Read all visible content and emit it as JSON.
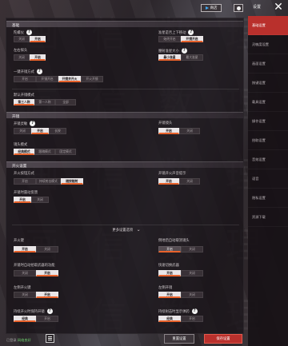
{
  "header": {
    "store_label": "商店",
    "settings_title": "设置"
  },
  "sidebar": {
    "items": [
      {
        "label": "基础设置",
        "active": true
      },
      {
        "label": "灵敏度设置",
        "active": false
      },
      {
        "label": "画面设置",
        "active": false
      },
      {
        "label": "按键设置",
        "active": false
      },
      {
        "label": "载具设置",
        "active": false
      },
      {
        "label": "操作设置",
        "active": false
      },
      {
        "label": "拾取设置",
        "active": false
      },
      {
        "label": "音效设置",
        "active": false
      },
      {
        "label": "语音",
        "active": false
      },
      {
        "label": "隐私设置",
        "active": false
      },
      {
        "label": "资源下载",
        "active": false
      }
    ]
  },
  "sections": {
    "basic": "基础",
    "shoot": "开镜",
    "shooting_settings": "开火设置"
  },
  "settings": [
    {
      "label": "陀螺仪",
      "help": true,
      "options": [
        "关闭",
        "开启"
      ],
      "selected": 1
    },
    {
      "label": "准星是否上下移动",
      "help": true,
      "options": [
        "始终开启",
        "开镜开启"
      ],
      "selected": 1
    },
    {
      "label": "左右探头",
      "help": false,
      "options": [
        "关闭",
        "开启"
      ],
      "selected": 1
    },
    {
      "label": "腰射准星大小",
      "help": true,
      "options": [
        "最小准星",
        "最大准星"
      ],
      "selected": 0
    },
    {
      "label": "一键开镜方式",
      "help": true,
      "options": [
        "开启",
        "开镜开启",
        "开镜并开火",
        "开火开镜"
      ],
      "selected": 2
    },
    {
      "label": "默认开镜模式",
      "help": false,
      "options": [
        "第三人称",
        "第一人称",
        "全部"
      ],
      "selected": 0
    },
    {
      "label": "开镜灵敏",
      "help": true,
      "options": [
        "关闭",
        "开启",
        "长按"
      ],
      "selected": 1
    },
    {
      "label": "开镜镜头",
      "help": false,
      "options": [
        "开启",
        "关闭"
      ],
      "selected": 0
    },
    {
      "label": "镜头模式",
      "help": false,
      "options": [
        "经典模式",
        "跟随模式",
        "固定模式"
      ],
      "selected": 0
    },
    {
      "label": "开火按钮方式",
      "help": false,
      "options": [
        "开启",
        "持续射击模式",
        "随按随射"
      ],
      "selected": 2
    },
    {
      "label": "开镜开火声音提示",
      "help": false,
      "options": [
        "开启",
        "关闭"
      ],
      "selected": 0
    },
    {
      "label": "开镜时震动反馈",
      "help": false,
      "options": [
        "开启",
        "关闭"
      ],
      "selected": 0
    },
    {
      "label": "开火键",
      "help": false,
      "options": [
        "开启",
        "关闭"
      ],
      "selected": 0
    },
    {
      "label": "倒地后自动取消镜头",
      "help": false,
      "options": [
        "开启",
        "关闭"
      ],
      "selected": 0
    },
    {
      "label": "开镜时自动拾取武器的功能",
      "help": false,
      "options": [
        "关闭",
        "开启"
      ],
      "selected": 1
    },
    {
      "label": "快速切换武器",
      "help": false,
      "options": [
        "开启",
        "关闭"
      ],
      "selected": 0
    },
    {
      "label": "左侧开火键",
      "help": false,
      "options": [
        "关闭",
        "开启"
      ],
      "selected": 1
    },
    {
      "label": "左侧开镜",
      "help": false,
      "options": [
        "开启",
        "关闭"
      ],
      "selected": 0
    },
    {
      "label": "持续开火时保持开镜",
      "help": true,
      "options": [
        "经典",
        "开启"
      ],
      "selected": 0
    },
    {
      "label": "持续射击时显示弹药",
      "help": true,
      "options": [
        "经典",
        "开启"
      ],
      "selected": 0
    }
  ],
  "more_settings": "更多设置选项",
  "footer": {
    "status": "已登录",
    "status_value": "网络良好",
    "default_button": "重置设置",
    "save_button": "保存设置"
  }
}
